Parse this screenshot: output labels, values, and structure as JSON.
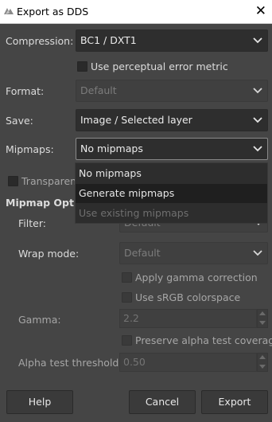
{
  "window": {
    "title": "Export as DDS",
    "close_icon": "close-icon"
  },
  "compression": {
    "label": "Compression:",
    "value": "BC1 / DXT1"
  },
  "perceptual": {
    "label": "Use perceptual error metric",
    "checked": false
  },
  "format": {
    "label": "Format:",
    "value": "Default",
    "disabled": true
  },
  "save": {
    "label": "Save:",
    "value": "Image / Selected layer"
  },
  "mipmaps": {
    "label": "Mipmaps:",
    "value": "No mipmaps",
    "options": [
      {
        "label": "No mipmaps",
        "highlighted": false,
        "disabled": false
      },
      {
        "label": "Generate mipmaps",
        "highlighted": true,
        "disabled": false
      },
      {
        "label": "Use existing mipmaps",
        "highlighted": false,
        "disabled": true
      }
    ]
  },
  "transparent": {
    "label": "Transparent"
  },
  "mipmap_options": {
    "heading": "Mipmap Optio",
    "filter": {
      "label": "Filter:",
      "value": "Default"
    },
    "wrap": {
      "label": "Wrap mode:",
      "value": "Default"
    },
    "gamma_correction": {
      "label": "Apply gamma correction"
    },
    "srgb": {
      "label": "Use sRGB colorspace"
    },
    "gamma": {
      "label": "Gamma:",
      "value": "2.2"
    },
    "alpha_coverage": {
      "label": "Preserve alpha test coverage"
    },
    "alpha_threshold": {
      "label": "Alpha test threshold:",
      "value": "0.50"
    }
  },
  "buttons": {
    "help": "Help",
    "cancel": "Cancel",
    "export": "Export"
  }
}
